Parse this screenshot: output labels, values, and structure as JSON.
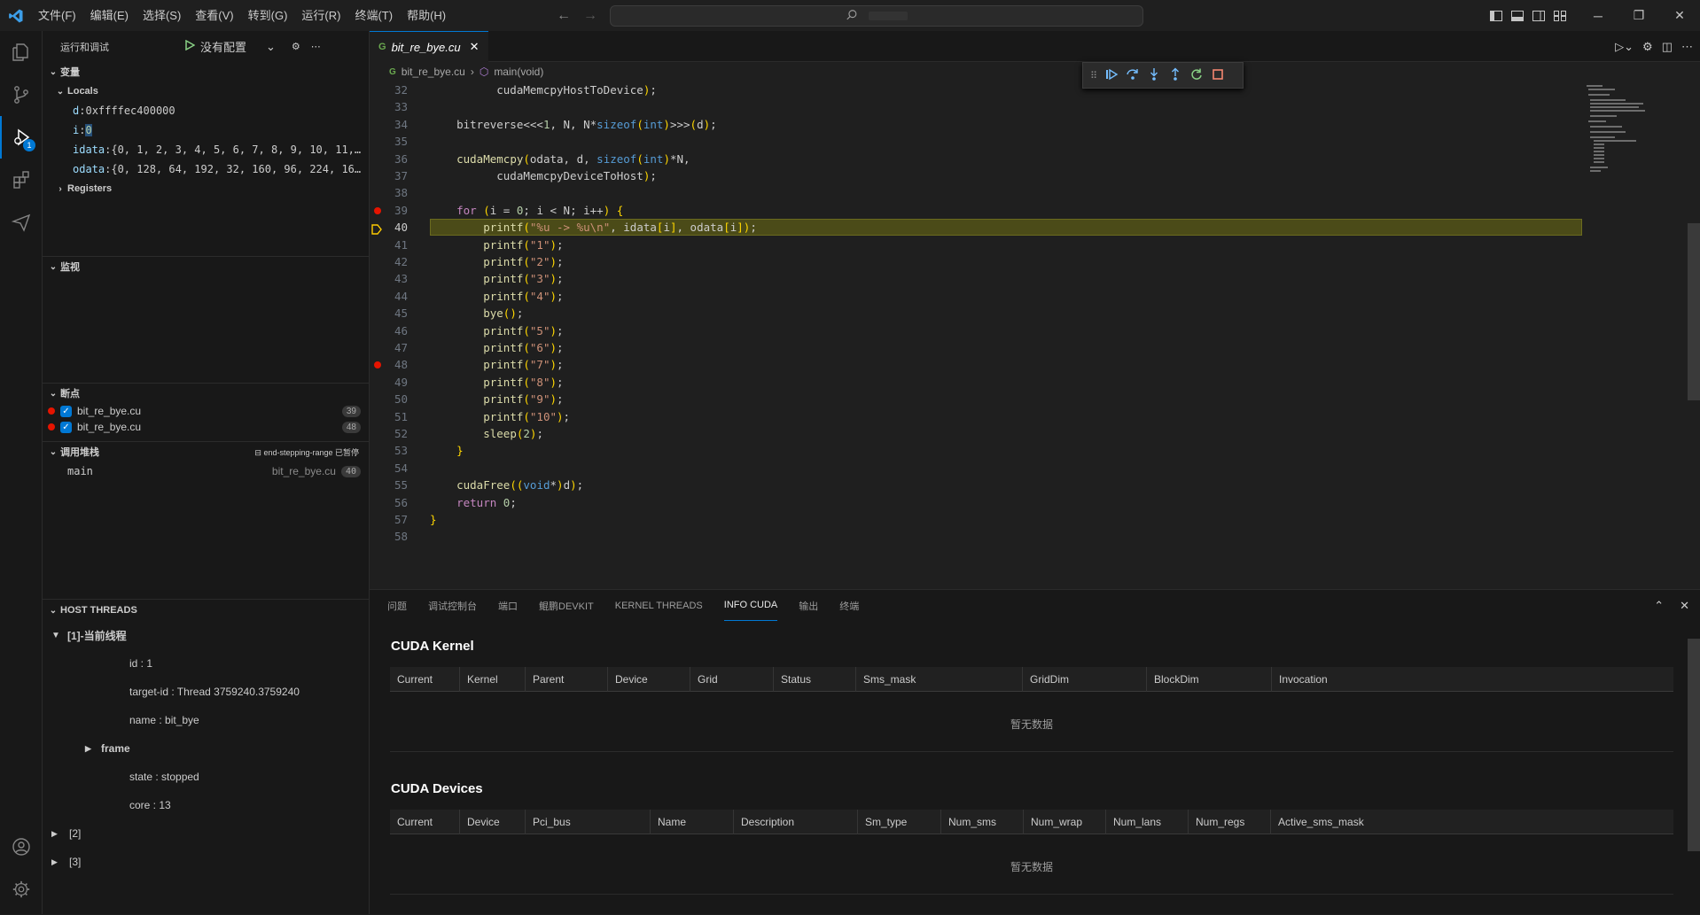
{
  "titlebar": {
    "menus": [
      "文件(F)",
      "编辑(E)",
      "选择(S)",
      "查看(V)",
      "转到(G)",
      "运行(R)",
      "终端(T)",
      "帮助(H)"
    ],
    "search_placeholder": ""
  },
  "activity": {
    "debug_badge": "1"
  },
  "sidebar": {
    "title": "运行和调试",
    "run_config": "没有配置",
    "variables": {
      "header": "变量",
      "locals_label": "Locals",
      "registers_label": "Registers",
      "items": [
        {
          "name": "d",
          "value": "0xffffec400000"
        },
        {
          "name": "i",
          "value": "0"
        },
        {
          "name": "idata",
          "value": "{0, 1, 2, 3, 4, 5, 6, 7, 8, 9, 10, 11,…"
        },
        {
          "name": "odata",
          "value": "{0, 128, 64, 192, 32, 160, 96, 224, 16…"
        }
      ]
    },
    "watch": {
      "header": "监视"
    },
    "breakpoints": {
      "header": "断点",
      "items": [
        {
          "file": "bit_re_bye.cu",
          "line": "39"
        },
        {
          "file": "bit_re_bye.cu",
          "line": "48"
        }
      ]
    },
    "callstack": {
      "header": "调用堆栈",
      "status": "end-stepping-range 已暂停",
      "frames": [
        {
          "name": "main",
          "file": "bit_re_bye.cu",
          "line": "40"
        }
      ]
    },
    "host_threads": {
      "header": "HOST THREADS",
      "current": "[1]-当前线程",
      "props": [
        "id : 1",
        "target-id : Thread 3759240.3759240",
        "name : bit_bye"
      ],
      "frame_label": "frame",
      "props2": [
        "state : stopped",
        "core : 13"
      ],
      "others": [
        "[2]",
        "[3]"
      ]
    }
  },
  "editor": {
    "tab_label": "bit_re_bye.cu",
    "breadcrumb": {
      "file": "bit_re_bye.cu",
      "symbol": "main(void)"
    },
    "lines": [
      {
        "n": "32",
        "t": "          cudaMemcpyHostToDevice);"
      },
      {
        "n": "33",
        "t": ""
      },
      {
        "n": "34",
        "t": "    bitreverse<<<1, N, N*sizeof(int)>>>(d);"
      },
      {
        "n": "35",
        "t": ""
      },
      {
        "n": "36",
        "t": "    cudaMemcpy(odata, d, sizeof(int)*N,"
      },
      {
        "n": "37",
        "t": "          cudaMemcpyDeviceToHost);"
      },
      {
        "n": "38",
        "t": ""
      },
      {
        "n": "39",
        "t": "    for (i = 0; i < N; i++) {"
      },
      {
        "n": "40",
        "t": "        printf(\"%u -> %u\\n\", idata[i], odata[i]);"
      },
      {
        "n": "41",
        "t": "        printf(\"1\");"
      },
      {
        "n": "42",
        "t": "        printf(\"2\");"
      },
      {
        "n": "43",
        "t": "        printf(\"3\");"
      },
      {
        "n": "44",
        "t": "        printf(\"4\");"
      },
      {
        "n": "45",
        "t": "        bye();"
      },
      {
        "n": "46",
        "t": "        printf(\"5\");"
      },
      {
        "n": "47",
        "t": "        printf(\"6\");"
      },
      {
        "n": "48",
        "t": "        printf(\"7\");"
      },
      {
        "n": "49",
        "t": "        printf(\"8\");"
      },
      {
        "n": "50",
        "t": "        printf(\"9\");"
      },
      {
        "n": "51",
        "t": "        printf(\"10\");"
      },
      {
        "n": "52",
        "t": "        sleep(2);"
      },
      {
        "n": "53",
        "t": "    }"
      },
      {
        "n": "54",
        "t": ""
      },
      {
        "n": "55",
        "t": "    cudaFree((void*)d);"
      },
      {
        "n": "56",
        "t": "    return 0;"
      },
      {
        "n": "57",
        "t": "}"
      },
      {
        "n": "58",
        "t": ""
      }
    ],
    "breakpoint_lines": [
      "39",
      "48"
    ],
    "current_line": "40"
  },
  "panel": {
    "tabs": [
      "问题",
      "调试控制台",
      "端口",
      "鲲鹏DEVKIT",
      "KERNEL THREADS",
      "INFO CUDA",
      "输出",
      "终端"
    ],
    "active_tab": "INFO CUDA",
    "kernel": {
      "title": "CUDA Kernel",
      "columns": [
        "Current",
        "Kernel",
        "Parent",
        "Device",
        "Grid",
        "Status",
        "Sms_mask",
        "GridDim",
        "BlockDim",
        "Invocation"
      ],
      "empty": "暂无数据"
    },
    "devices": {
      "title": "CUDA Devices",
      "columns": [
        "Current",
        "Device",
        "Pci_bus",
        "Name",
        "Description",
        "Sm_type",
        "Num_sms",
        "Num_wrap",
        "Num_lans",
        "Num_regs",
        "Active_sms_mask"
      ],
      "empty": "暂无数据"
    }
  },
  "colors": {
    "accent": "#0078d4",
    "breakpoint": "#e51400",
    "current_line": "#4b4b18"
  }
}
